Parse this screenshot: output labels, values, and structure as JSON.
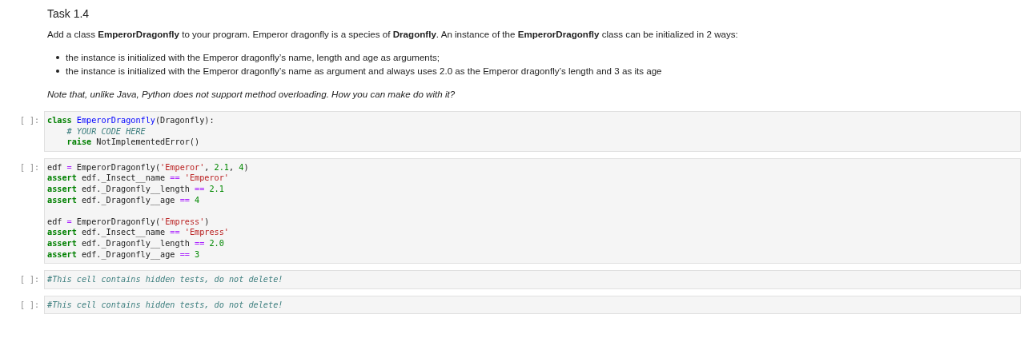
{
  "markdown": {
    "heading": "Task 1.4",
    "intro": "Add a class **EmperorDragonfly** to your program. Emperor dragonfly is a species of **Dragonfly**. An instance of the **EmperorDragonfly** class can be initialized in 2 ways:",
    "bullets": [
      "the instance is initialized with the Emperor dragonfly’s name, length and age as arguments;",
      "the instance is initialized with the Emperor dragonfly’s name as argument and always uses 2.0 as the Emperor dragonfly’s length and 3 as its age"
    ],
    "note": "Note that, unlike Java, Python does not support method overloading. How you can make do with it?"
  },
  "cells": [
    {
      "prompt": "[ ]:",
      "lines": [
        {
          "kind": "code",
          "tokens": [
            {
              "kind": "kw",
              "text": "class "
            },
            {
              "kind": "cls",
              "text": "EmperorDragonfly"
            },
            {
              "kind": "plain",
              "text": "(Dragonfly):"
            }
          ]
        },
        {
          "kind": "code",
          "tokens": [
            {
              "kind": "comment",
              "text": "    # YOUR CODE HERE"
            }
          ]
        },
        {
          "kind": "code",
          "tokens": [
            {
              "kind": "kw",
              "text": "    raise"
            },
            {
              "kind": "plain",
              "text": " NotImplementedError()"
            }
          ]
        }
      ]
    },
    {
      "prompt": "[ ]:",
      "lines": [
        {
          "kind": "code",
          "tokens": [
            {
              "kind": "plain",
              "text": "edf "
            },
            {
              "kind": "op",
              "text": "="
            },
            {
              "kind": "plain",
              "text": " EmperorDragonfly("
            },
            {
              "kind": "str",
              "text": "'Emperor'"
            },
            {
              "kind": "plain",
              "text": ", "
            },
            {
              "kind": "num",
              "text": "2.1"
            },
            {
              "kind": "plain",
              "text": ", "
            },
            {
              "kind": "num",
              "text": "4"
            },
            {
              "kind": "plain",
              "text": ")"
            }
          ]
        },
        {
          "kind": "code",
          "tokens": [
            {
              "kind": "kw",
              "text": "assert"
            },
            {
              "kind": "plain",
              "text": " edf._Insect__name "
            },
            {
              "kind": "op",
              "text": "== "
            },
            {
              "kind": "str",
              "text": "'Emperor'"
            }
          ]
        },
        {
          "kind": "code",
          "tokens": [
            {
              "kind": "kw",
              "text": "assert"
            },
            {
              "kind": "plain",
              "text": " edf._Dragonfly__length "
            },
            {
              "kind": "op",
              "text": "== "
            },
            {
              "kind": "num",
              "text": "2.1"
            }
          ]
        },
        {
          "kind": "code",
          "tokens": [
            {
              "kind": "kw",
              "text": "assert"
            },
            {
              "kind": "plain",
              "text": " edf._Dragonfly__age "
            },
            {
              "kind": "op",
              "text": "== "
            },
            {
              "kind": "num",
              "text": "4"
            }
          ]
        },
        {
          "kind": "blank"
        },
        {
          "kind": "code",
          "tokens": [
            {
              "kind": "plain",
              "text": "edf "
            },
            {
              "kind": "op",
              "text": "="
            },
            {
              "kind": "plain",
              "text": " EmperorDragonfly("
            },
            {
              "kind": "str",
              "text": "'Empress'"
            },
            {
              "kind": "plain",
              "text": ")"
            }
          ]
        },
        {
          "kind": "code",
          "tokens": [
            {
              "kind": "kw",
              "text": "assert"
            },
            {
              "kind": "plain",
              "text": " edf._Insect__name "
            },
            {
              "kind": "op",
              "text": "== "
            },
            {
              "kind": "str",
              "text": "'Empress'"
            }
          ]
        },
        {
          "kind": "code",
          "tokens": [
            {
              "kind": "kw",
              "text": "assert"
            },
            {
              "kind": "plain",
              "text": " edf._Dragonfly__length "
            },
            {
              "kind": "op",
              "text": "== "
            },
            {
              "kind": "num",
              "text": "2.0"
            }
          ]
        },
        {
          "kind": "code",
          "tokens": [
            {
              "kind": "kw",
              "text": "assert"
            },
            {
              "kind": "plain",
              "text": " edf._Dragonfly__age "
            },
            {
              "kind": "op",
              "text": "== "
            },
            {
              "kind": "num",
              "text": "3"
            }
          ]
        }
      ]
    },
    {
      "prompt": "[ ]:",
      "lines": [
        {
          "kind": "code",
          "tokens": [
            {
              "kind": "comment",
              "text": "#This cell contains hidden tests, do not delete!"
            }
          ]
        }
      ]
    },
    {
      "prompt": "[ ]:",
      "lines": [
        {
          "kind": "code",
          "tokens": [
            {
              "kind": "comment",
              "text": "#This cell contains hidden tests, do not delete!"
            }
          ]
        }
      ]
    }
  ]
}
